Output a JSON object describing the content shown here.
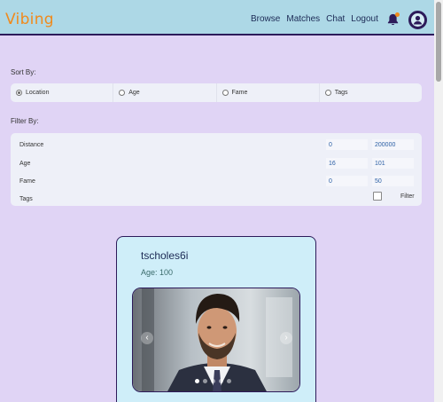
{
  "header": {
    "brand": "Vibing",
    "nav": [
      "Browse",
      "Matches",
      "Chat",
      "Logout"
    ],
    "brand_color": "#f08a1c",
    "bar_color": "#add8e6"
  },
  "sort": {
    "label": "Sort By:",
    "options": [
      "Location",
      "Age",
      "Fame",
      "Tags"
    ],
    "selected": "Location"
  },
  "filter": {
    "label": "Filter By:",
    "rows": [
      {
        "name": "Distance",
        "min": "0",
        "max": "200000"
      },
      {
        "name": "Age",
        "min": "16",
        "max": "101"
      },
      {
        "name": "Fame",
        "min": "0",
        "max": "50"
      }
    ],
    "tags_label": "Tags",
    "tags_checked": false,
    "button": "Filter"
  },
  "profile": {
    "username": "tscholes6i",
    "age": "Age: 100",
    "photo_count": 5,
    "active_photo_index": 0
  },
  "icons": [
    "bell-icon",
    "user-avatar-icon",
    "chevron-left-icon",
    "chevron-right-icon"
  ],
  "colors": {
    "background": "#e0d4f5",
    "card": "#cfeef9",
    "accent": "#2d1b5a"
  }
}
